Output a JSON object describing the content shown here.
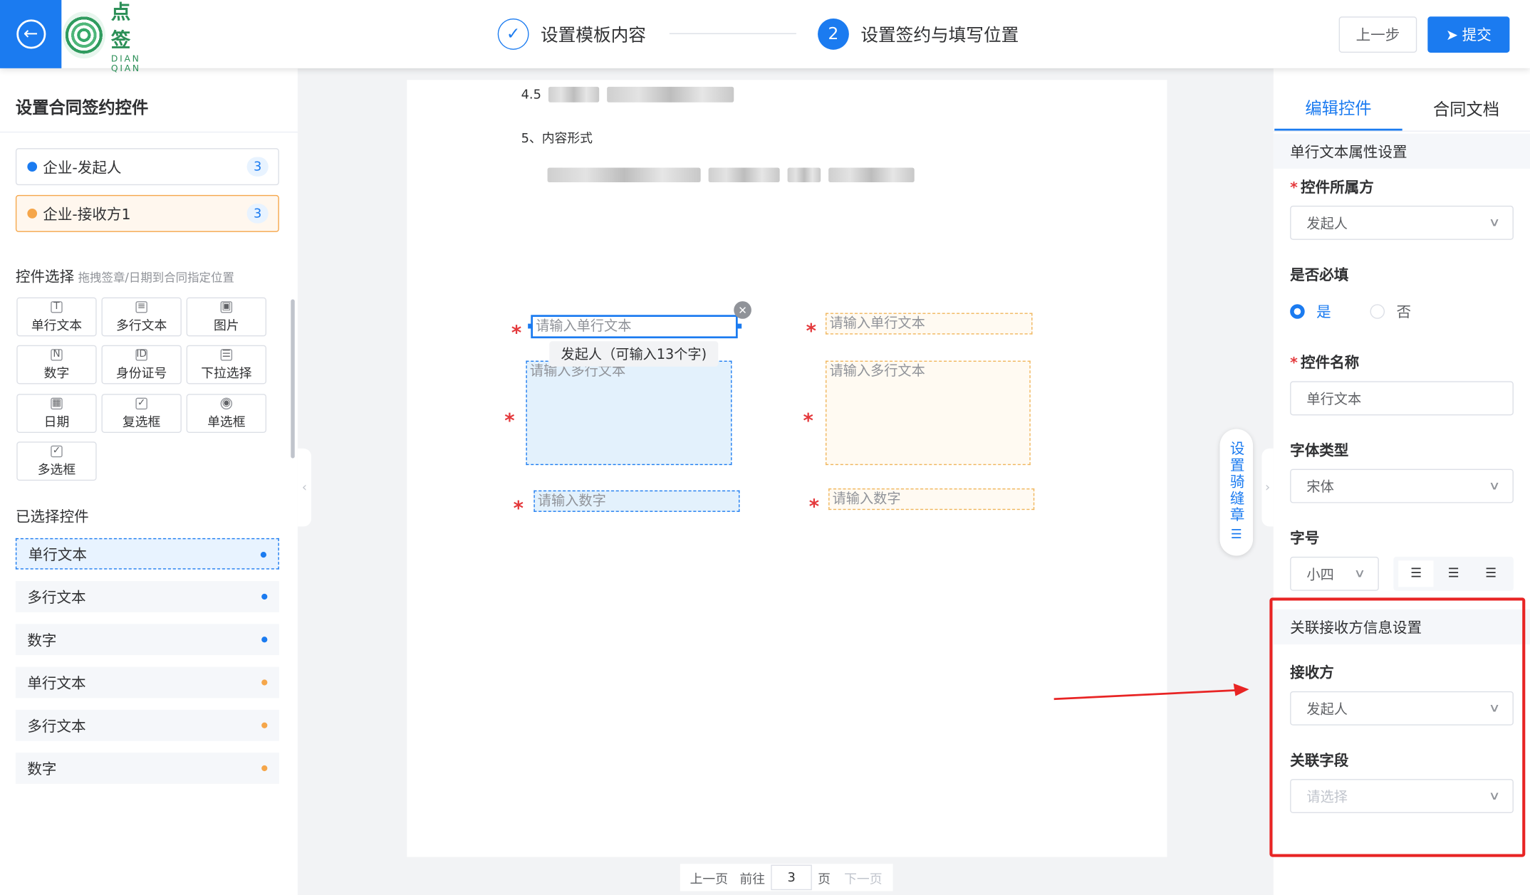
{
  "header": {
    "logo_cn": "点 签",
    "logo_en": "DIAN QIAN",
    "steps": [
      {
        "num": "✓",
        "label": "设置模板内容"
      },
      {
        "num": "2",
        "label": "设置签约与填写位置"
      }
    ],
    "prev_label": "上一步",
    "submit_label": "提交"
  },
  "left": {
    "title": "设置合同签约控件",
    "parties": [
      {
        "name": "企业-发起人",
        "count": "3",
        "color": "#1b7bf0"
      },
      {
        "name": "企业-接收方1",
        "count": "3",
        "color": "#f5a64a"
      }
    ],
    "controls_title": "控件选择",
    "controls_hint": "拖拽签章/日期到合同指定位置",
    "controls": [
      {
        "label": "单行文本",
        "icon": "T"
      },
      {
        "label": "多行文本",
        "icon": "≡"
      },
      {
        "label": "图片",
        "icon": "▣"
      },
      {
        "label": "数字",
        "icon": "N"
      },
      {
        "label": "身份证号",
        "icon": "ID"
      },
      {
        "label": "下拉选择",
        "icon": "☰"
      },
      {
        "label": "日期",
        "icon": "▦"
      },
      {
        "label": "复选框",
        "icon": "✓"
      },
      {
        "label": "单选框",
        "icon": "◉"
      },
      {
        "label": "多选框",
        "icon": "✓"
      }
    ],
    "selected_title": "已选择控件",
    "selected": [
      {
        "label": "单行文本",
        "color": "#1b7bf0"
      },
      {
        "label": "多行文本",
        "color": "#1b7bf0"
      },
      {
        "label": "数字",
        "color": "#1b7bf0"
      },
      {
        "label": "单行文本",
        "color": "#f5a64a"
      },
      {
        "label": "多行文本",
        "color": "#f5a64a"
      },
      {
        "label": "数字",
        "color": "#f5a64a"
      }
    ]
  },
  "doc": {
    "line1_num": "4.5",
    "line2": "5、内容形式",
    "single_ph": "请输入单行文本",
    "multi_ph": "请输入多行文本",
    "number_ph": "请输入数字",
    "tooltip": "发起人（可输入13个字)",
    "star": "*"
  },
  "pager": {
    "prev": "上一页",
    "goto": "前往",
    "page": "3",
    "unit": "页",
    "next": "下一页"
  },
  "seam_label": "设置骑缝章",
  "right": {
    "tabs": [
      "编辑控件",
      "合同文档"
    ],
    "section1": "单行文本属性设置",
    "owner_label": "控件所属方",
    "owner_value": "发起人",
    "required_label": "是否必填",
    "yes": "是",
    "no": "否",
    "name_label": "控件名称",
    "name_value": "单行文本",
    "font_label": "字体类型",
    "font_value": "宋体",
    "size_label": "字号",
    "size_value": "小四",
    "section2": "关联接收方信息设置",
    "receiver_label": "接收方",
    "receiver_value": "发起人",
    "field_label": "关联字段",
    "field_placeholder": "请选择"
  }
}
